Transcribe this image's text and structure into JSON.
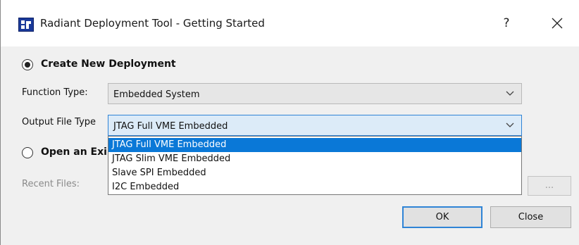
{
  "window": {
    "title": "Radiant Deployment Tool - Getting Started",
    "help_label": "?",
    "icons": {
      "app": "app-logo-icon",
      "close": "close-icon",
      "chevron": "chevron-down-icon"
    }
  },
  "create_new": {
    "label": "Create New Deployment",
    "selected": true,
    "function_type": {
      "label": "Function Type:",
      "value": "Embedded System"
    },
    "output_file_type": {
      "label": "Output File Type",
      "value": "JTAG Full VME Embedded",
      "options": [
        "JTAG Full VME Embedded",
        "JTAG Slim VME Embedded",
        "Slave SPI Embedded",
        "I2C Embedded"
      ],
      "selected_index": 0
    }
  },
  "open_existing": {
    "label": "Open an Exi",
    "selected": false,
    "recent_files_label": "Recent Files:",
    "browse_label": "..."
  },
  "buttons": {
    "ok": "OK",
    "close": "Close"
  },
  "colors": {
    "accent": "#0a78d7",
    "focus_border": "#2f84d6"
  }
}
